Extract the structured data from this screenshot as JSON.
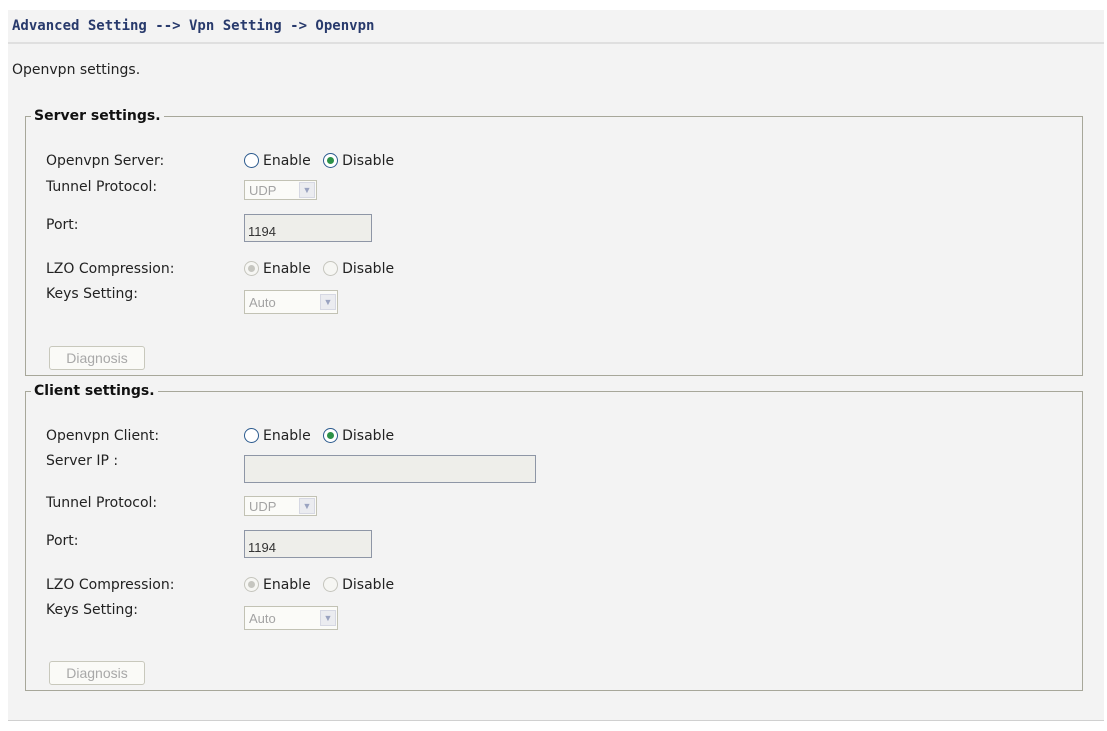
{
  "breadcrumb": "Advanced Setting --> Vpn Setting -> Openvpn",
  "intro": "Openvpn settings.",
  "server": {
    "legend": "Server settings.",
    "openvpn_label": "Openvpn Server:",
    "enable_label": "Enable",
    "disable_label": "Disable",
    "openvpn_selected": "Disable",
    "protocol_label": "Tunnel Protocol:",
    "protocol_value": "UDP",
    "port_label": "Port:",
    "port_value": "1194",
    "lzo_label": "LZO Compression:",
    "lzo_selected": "Enable",
    "keys_label": "Keys Setting:",
    "keys_value": "Auto",
    "diagnosis_label": "Diagnosis"
  },
  "client": {
    "legend": "Client settings.",
    "openvpn_label": "Openvpn Client:",
    "enable_label": "Enable",
    "disable_label": "Disable",
    "openvpn_selected": "Disable",
    "server_ip_label": "Server IP :",
    "server_ip_value": "",
    "protocol_label": "Tunnel Protocol:",
    "protocol_value": "UDP",
    "port_label": "Port:",
    "port_value": "1194",
    "lzo_label": "LZO Compression:",
    "lzo_selected": "Enable",
    "keys_label": "Keys Setting:",
    "keys_value": "Auto",
    "diagnosis_label": "Diagnosis"
  },
  "icons": {
    "dropdown": "chevron-down-icon"
  }
}
